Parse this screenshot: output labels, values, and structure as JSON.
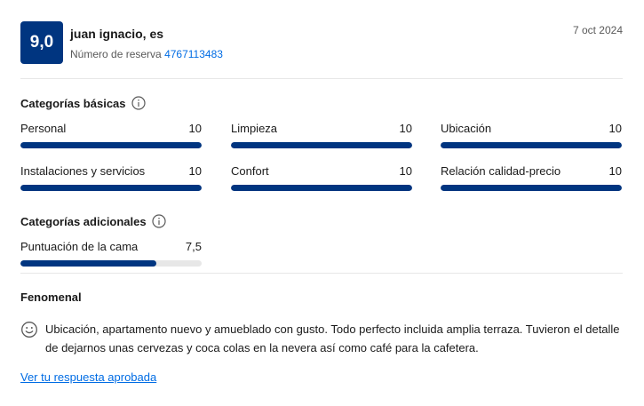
{
  "header": {
    "score": "9,0",
    "reviewer": "juan ignacio, es",
    "booking_label": "Número de reserva",
    "booking_number": "4767113483",
    "date": "7 oct 2024"
  },
  "basic": {
    "title": "Categorías básicas",
    "items": [
      {
        "label": "Personal",
        "score": "10",
        "fraction": 1.0
      },
      {
        "label": "Limpieza",
        "score": "10",
        "fraction": 1.0
      },
      {
        "label": "Ubicación",
        "score": "10",
        "fraction": 1.0
      },
      {
        "label": "Instalaciones y servicios",
        "score": "10",
        "fraction": 1.0
      },
      {
        "label": "Confort",
        "score": "10",
        "fraction": 1.0
      },
      {
        "label": "Relación calidad-precio",
        "score": "10",
        "fraction": 1.0
      }
    ]
  },
  "additional": {
    "title": "Categorías adicionales",
    "items": [
      {
        "label": "Puntuación de la cama",
        "score": "7,5",
        "fraction": 0.75
      }
    ]
  },
  "review": {
    "title": "Fenomenal",
    "text": "Ubicación, apartamento nuevo y amueblado con gusto. Todo perfecto incluida amplia terraza. Tuvieron el detalle de dejarnos unas cervezas y coca colas en la nevera así como café para la cafetera."
  },
  "link": {
    "label": "Ver tu respuesta aprobada"
  },
  "colors": {
    "brand": "#003580",
    "link": "#006ce4",
    "track": "#e7e7e7"
  },
  "icons": {
    "info": "info-icon",
    "sentiment": "smile-icon"
  }
}
